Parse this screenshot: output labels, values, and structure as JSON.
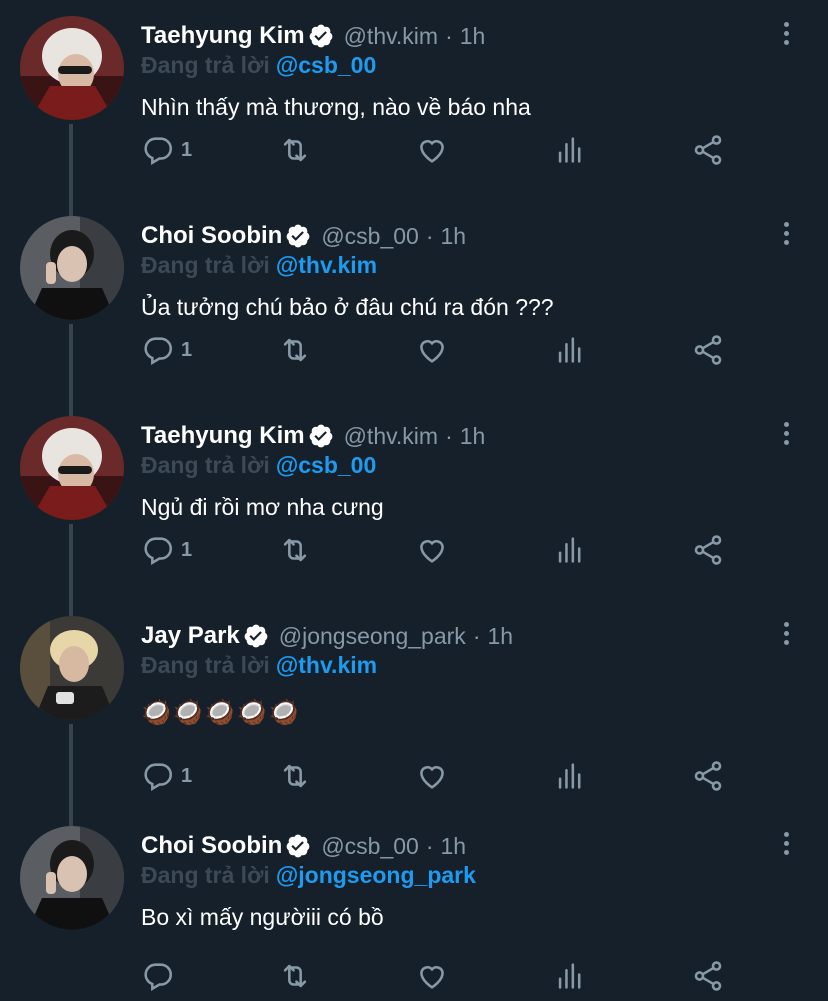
{
  "tweets": [
    {
      "name": "Taehyung Kim",
      "handle": "@thv.kim",
      "time": "1h",
      "replying_prefix": "Đang trả lời",
      "replying_to": "@csb_00",
      "text": "Nhìn thấy mà thương, nào về báo nha",
      "reply_count": "1",
      "avatar": "taehyung-avatar"
    },
    {
      "name": "Choi Soobin",
      "handle": "@csb_00",
      "time": "1h",
      "replying_prefix": "Đang trả lời",
      "replying_to": "@thv.kim",
      "text": "Ủa tưởng chú bảo ở đâu chú ra đón ???",
      "reply_count": "1",
      "avatar": "soobin-avatar"
    },
    {
      "name": "Taehyung Kim",
      "handle": "@thv.kim",
      "time": "1h",
      "replying_prefix": "Đang trả lời",
      "replying_to": "@csb_00",
      "text": "Ngủ đi rồi mơ nha cưng",
      "reply_count": "1",
      "avatar": "taehyung-avatar"
    },
    {
      "name": "Jay Park",
      "handle": "@jongseong_park",
      "time": "1h",
      "replying_prefix": "Đang trả lời",
      "replying_to": "@thv.kim",
      "text": "🥥🥥🥥🥥🥥",
      "reply_count": "1",
      "avatar": "jay-avatar"
    },
    {
      "name": "Choi Soobin",
      "handle": "@csb_00",
      "time": "1h",
      "replying_prefix": "Đang trả lời",
      "replying_to": "@jongseong_park",
      "text": "Bo xì mấy ngườiii có bồ",
      "reply_count": "",
      "avatar": "soobin-avatar"
    }
  ],
  "colors": {
    "background": "#15202b",
    "secondary_text": "#8899a6",
    "replying_prefix": "#3d4a55",
    "mention": "#1d9bf0",
    "thread_line": "#38444d"
  },
  "icons": [
    "reply-icon",
    "retweet-icon",
    "like-icon",
    "analytics-icon",
    "share-icon",
    "verified-icon",
    "more-icon"
  ]
}
